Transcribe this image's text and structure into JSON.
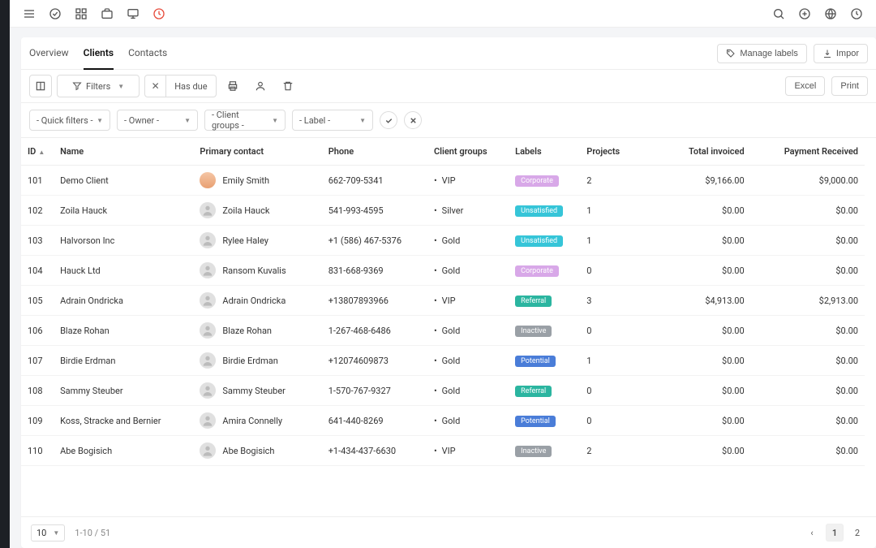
{
  "tabs": {
    "overview": "Overview",
    "clients": "Clients",
    "contacts": "Contacts",
    "manage_labels": "Manage labels",
    "import": "Impor"
  },
  "toolbar": {
    "filters": "Filters",
    "has_due": "Has due",
    "excel": "Excel",
    "print": "Print"
  },
  "filters": {
    "quick": "- Quick filters -",
    "owner": "- Owner -",
    "groups": "- Client groups -",
    "label": "- Label -"
  },
  "columns": {
    "id": "ID",
    "name": "Name",
    "contact": "Primary contact",
    "phone": "Phone",
    "groups": "Client groups",
    "labels": "Labels",
    "projects": "Projects",
    "invoiced": "Total invoiced",
    "payment": "Payment Received"
  },
  "rows": [
    {
      "id": "101",
      "name": "Demo Client",
      "contact": "Emily Smith",
      "photo": true,
      "phone": "662-709-5341",
      "group": "VIP",
      "label": "Corporate",
      "projects": "2",
      "invoiced": "$9,166.00",
      "payment": "$9,000.00"
    },
    {
      "id": "102",
      "name": "Zoila Hauck",
      "contact": "Zoila Hauck",
      "photo": false,
      "phone": "541-993-4595",
      "group": "Silver",
      "label": "Unsatisfied",
      "projects": "1",
      "invoiced": "$0.00",
      "payment": "$0.00"
    },
    {
      "id": "103",
      "name": "Halvorson Inc",
      "contact": "Rylee Haley",
      "photo": false,
      "phone": "+1 (586) 467-5376",
      "group": "Gold",
      "label": "Unsatisfied",
      "projects": "1",
      "invoiced": "$0.00",
      "payment": "$0.00"
    },
    {
      "id": "104",
      "name": "Hauck Ltd",
      "contact": "Ransom Kuvalis",
      "photo": false,
      "phone": "831-668-9369",
      "group": "Gold",
      "label": "Corporate",
      "projects": "0",
      "invoiced": "$0.00",
      "payment": "$0.00"
    },
    {
      "id": "105",
      "name": "Adrain Ondricka",
      "contact": "Adrain Ondricka",
      "photo": false,
      "phone": "+13807893966",
      "group": "VIP",
      "label": "Referral",
      "projects": "3",
      "invoiced": "$4,913.00",
      "payment": "$2,913.00"
    },
    {
      "id": "106",
      "name": "Blaze Rohan",
      "contact": "Blaze Rohan",
      "photo": false,
      "phone": "1-267-468-6486",
      "group": "Gold",
      "label": "Inactive",
      "projects": "0",
      "invoiced": "$0.00",
      "payment": "$0.00"
    },
    {
      "id": "107",
      "name": "Birdie Erdman",
      "contact": "Birdie Erdman",
      "photo": false,
      "phone": "+12074609873",
      "group": "Gold",
      "label": "Potential",
      "projects": "1",
      "invoiced": "$0.00",
      "payment": "$0.00"
    },
    {
      "id": "108",
      "name": "Sammy Steuber",
      "contact": "Sammy Steuber",
      "photo": false,
      "phone": "1-570-767-9327",
      "group": "Gold",
      "label": "Referral",
      "projects": "0",
      "invoiced": "$0.00",
      "payment": "$0.00"
    },
    {
      "id": "109",
      "name": "Koss, Stracke and Bernier",
      "contact": "Amira Connelly",
      "photo": false,
      "phone": "641-440-8269",
      "group": "Gold",
      "label": "Potential",
      "projects": "0",
      "invoiced": "$0.00",
      "payment": "$0.00"
    },
    {
      "id": "110",
      "name": "Abe Bogisich",
      "contact": "Abe Bogisich",
      "photo": false,
      "phone": "+1-434-437-6630",
      "group": "VIP",
      "label": "Inactive",
      "projects": "2",
      "invoiced": "$0.00",
      "payment": "$0.00"
    }
  ],
  "pager": {
    "size": "10",
    "info": "1-10 / 51",
    "p1": "1",
    "p2": "2"
  }
}
